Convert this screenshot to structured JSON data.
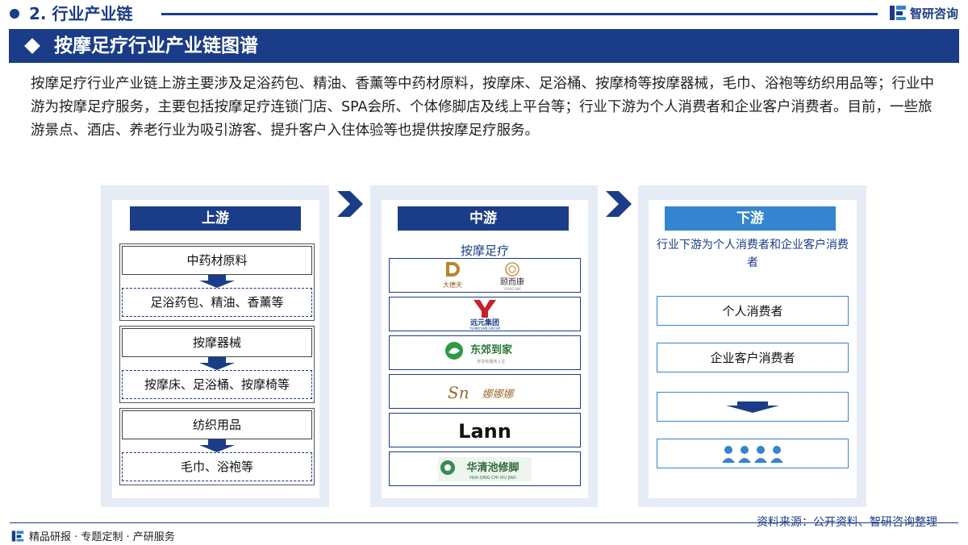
{
  "section": {
    "title": "2. 行业产业链"
  },
  "brand": {
    "name": "智研咨询",
    "icon": "zhiyan-logo-icon"
  },
  "title": "按摩足疗行业产业链图谱",
  "intro": "按摩足疗行业产业链上游主要涉及足浴药包、精油、香薰等中药材原料，按摩床、足浴桶、按摩椅等按摩器械，毛巾、浴袍等纺织用品等；行业中游为按摩足疗服务，主要包括按摩足疗连锁门店、SPA会所、个体修脚店及线上平台等；行业下游为个人消费者和企业客户消费者。目前，一些旅游景点、酒店、养老行业为吸引游客、提升客户入住体验等也提供按摩足疗服务。",
  "upstream": {
    "header": "上游",
    "groups": [
      {
        "title": "中药材原料",
        "items": "足浴药包、精油、香薰等"
      },
      {
        "title": "按摩器械",
        "items": "按摩床、足浴桶、按摩椅等"
      },
      {
        "title": "纺织用品",
        "items": "毛巾、浴袍等"
      }
    ]
  },
  "midstream": {
    "header": "中游",
    "label": "按摩足疗",
    "logos": [
      {
        "name": "大德天",
        "sub": ""
      },
      {
        "name": "颐而康",
        "sub": "YEARCONE"
      },
      {
        "name": "远元集团",
        "sub": "YUANYUAN GROUP"
      },
      {
        "name": "东郊到家",
        "sub": "你享你服务入生"
      },
      {
        "name": "娜娜娜",
        "sub": ""
      },
      {
        "name": "Lann",
        "sub": ""
      },
      {
        "name": "华清池修脚",
        "sub": "HUA QING CHI XIU JIAO"
      }
    ]
  },
  "downstream": {
    "header": "下游",
    "desc": "行业下游为个人消费者和企业客户消费者",
    "items": [
      "个人消费者",
      "企业客户消费者"
    ]
  },
  "footer": {
    "left": "精品研报 · 专题定制 · 产研服务",
    "source": "资料来源：公开资料、智研咨询整理"
  },
  "colors": {
    "primary": "#1b3c88",
    "accent": "#3484cf",
    "panel": "#e6ecf5"
  }
}
